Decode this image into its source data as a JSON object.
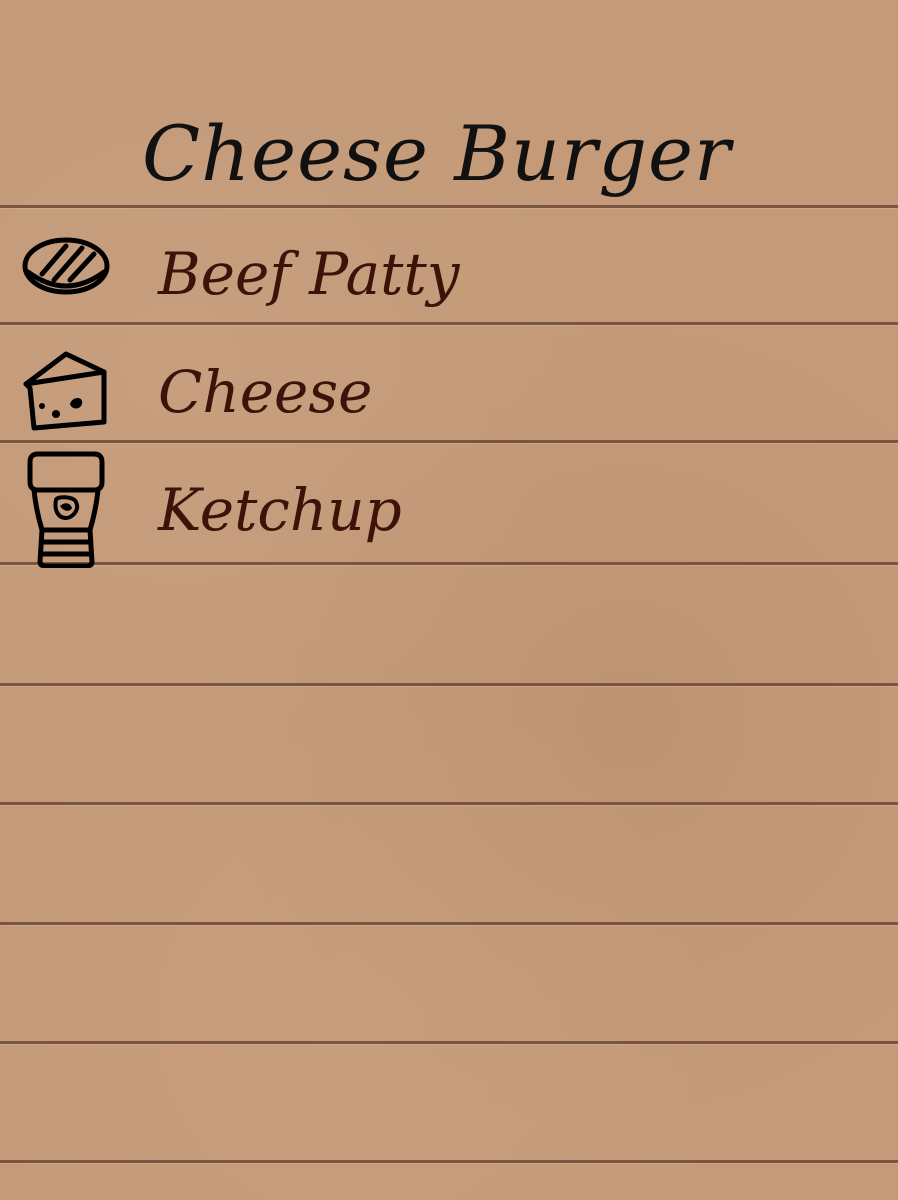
{
  "recipe": {
    "title": "Cheese Burger",
    "ingredients": [
      {
        "label": "Beef Patty",
        "icon": "beef-patty-icon"
      },
      {
        "label": "Cheese",
        "icon": "cheese-icon"
      },
      {
        "label": "Ketchup",
        "icon": "ketchup-bottle-icon"
      }
    ]
  },
  "colors": {
    "paper": "#c49a78",
    "rule": "#6d4a36",
    "title_text": "#111111",
    "ingredient_text": "#3d1208"
  }
}
